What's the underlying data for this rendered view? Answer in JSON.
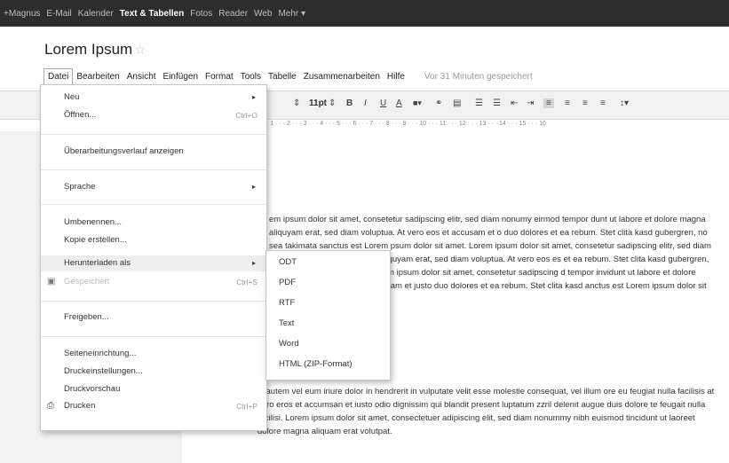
{
  "topnav": {
    "items": [
      "+Magnus",
      "E-Mail",
      "Kalender",
      "Text & Tabellen",
      "Fotos",
      "Reader",
      "Web",
      "Mehr ▾"
    ],
    "active_index": 3
  },
  "doc": {
    "title": "Lorem Ipsum",
    "saved_status": "Vor 31 Minuten gespeichert"
  },
  "menubar": [
    "Datei",
    "Bearbeiten",
    "Ansicht",
    "Einfügen",
    "Format",
    "Tools",
    "Tabelle",
    "Zusammenarbeiten",
    "Hilfe"
  ],
  "toolbar": {
    "font_size": "11pt",
    "bold": "B",
    "italic": "I",
    "underline": "U",
    "text_color": "A"
  },
  "ruler_text": "· 1 · · · 2 · · · 3 · · · 4 · · · 5 · · · 6 · · · 7 · · · 8 · · · 9 · · · 10 · · · 11 · · · 12 · · · 13 · · · 14 · · · 15 · · · 16",
  "file_menu": {
    "items": [
      {
        "label": "Neu",
        "arrow": "▸"
      },
      {
        "label": "Öffnen...",
        "shortcut": "Ctrl+O"
      },
      {
        "label": "Überarbeitungsverlauf anzeigen"
      },
      {
        "label": "Sprache",
        "arrow": "▸"
      },
      {
        "label": "Umbenennen..."
      },
      {
        "label": "Kopie erstellen..."
      },
      {
        "label": "Herunterladen als",
        "arrow": "▸"
      },
      {
        "label": "Gespeichert",
        "shortcut": "Ctrl+S"
      },
      {
        "label": "Freigeben..."
      },
      {
        "label": "Seiteneinrichtung..."
      },
      {
        "label": "Druckeinstellungen..."
      },
      {
        "label": "Druckvorschau"
      },
      {
        "label": "Drucken",
        "shortcut": "Ctrl+P"
      }
    ]
  },
  "download_submenu": {
    "items": [
      "ODT",
      "PDF",
      "RTF",
      "Text",
      "Word",
      "HTML (ZIP-Format)"
    ]
  },
  "document_text": {
    "para1": "em ipsum dolor sit amet, consetetur sadipscing elitr, sed diam nonumy eirmod tempor dunt ut labore et dolore magna aliquyam erat, sed diam voluptua. At vero eos et accusam et o duo dolores et ea rebum. Stet clita kasd gubergren, no sea takimata sanctus est Lorem psum dolor sit amet. Lorem ipsum dolor sit amet, consetetur sadipscing elitr, sed diam nonumy ore et dolore magna aliquyam erat, sed diam voluptua. At vero eos es et ea rebum. Stet clita kasd gubergren, no sea takimata r sit amet. Lorem ipsum dolor sit amet, consetetur sadipscing d tempor invidunt ut labore et dolore magna aliquyam erat, sed accusam et justo duo dolores et ea rebum. Stet clita kasd anctus est Lorem ipsum dolor sit amet.",
    "para2": "is autem vel eum iriure dolor in hendrerit in vulputate velit esse molestie consequat, vel illum ore eu feugiat nulla facilisis at vero eros et accumsan et iusto odio dignissim qui blandit present luptatum zzril delenit augue duis dolore te feugait nulla facilisi. Lorem ipsum dolor sit amet, consectetuer adipiscing elit, sed diam nonummy nibh euismod tincidunt ut laoreet dolore magna aliquam erat volutpat."
  }
}
